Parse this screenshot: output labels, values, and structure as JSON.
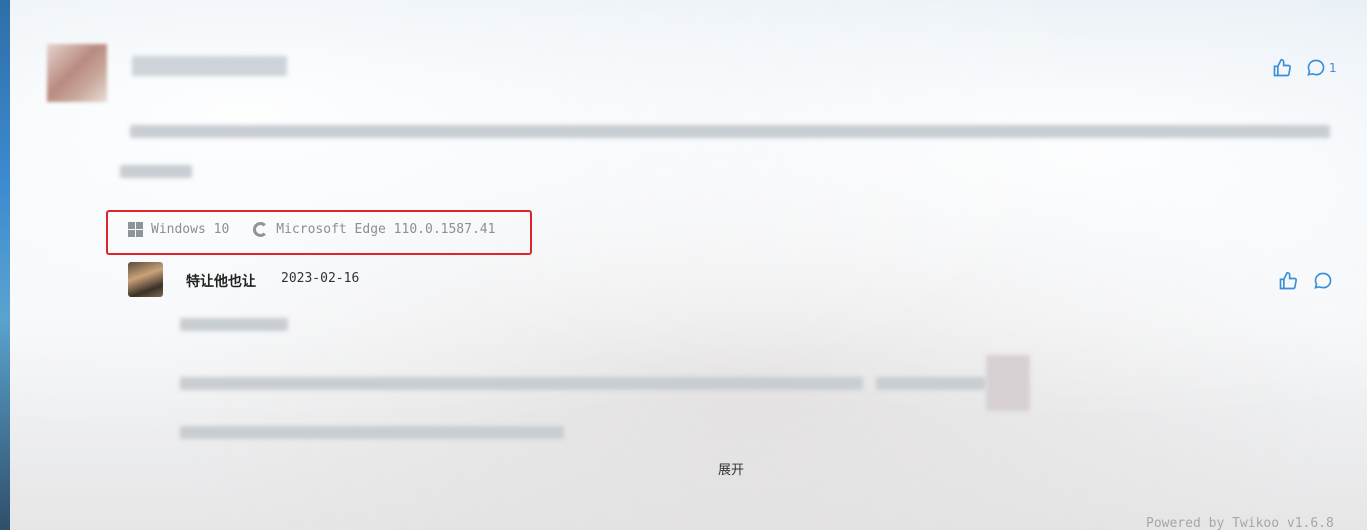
{
  "comment": {
    "os": "Windows 10",
    "browser": "Microsoft Edge 110.0.1587.41",
    "reply_count": "1"
  },
  "reply": {
    "author": "特让他也让",
    "date": "2023-02-16"
  },
  "expand_label": "展开",
  "footer": {
    "powered_by": "Powered by Twikoo v1.6.8"
  },
  "icons": {
    "like": "thumbs-up-icon",
    "reply": "comment-bubble-icon",
    "os": "windows-icon",
    "browser": "edge-icon"
  },
  "colors": {
    "accent": "#3a8fd8",
    "highlight": "#e0242a"
  }
}
